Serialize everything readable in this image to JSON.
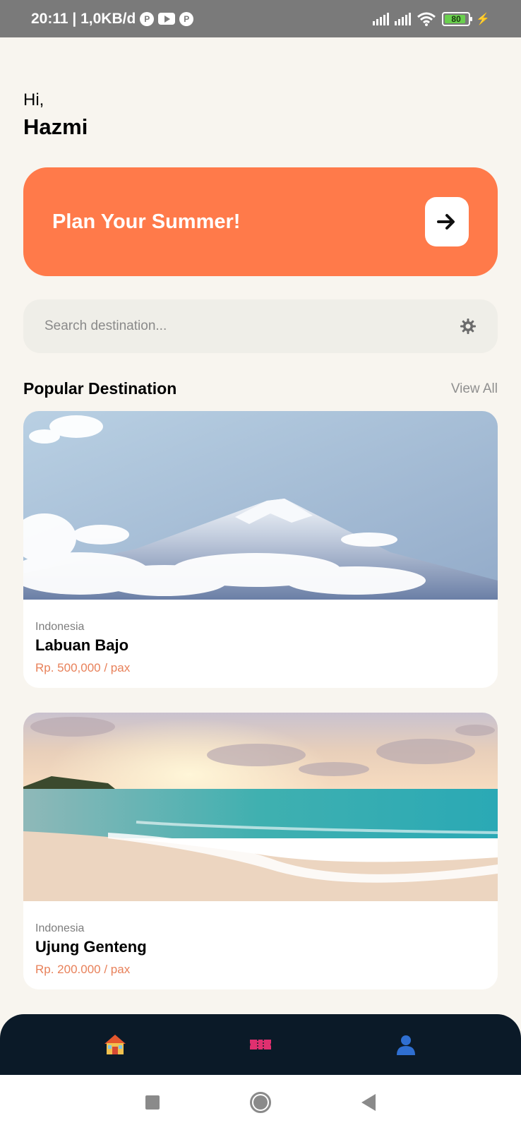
{
  "status_bar": {
    "time": "20:11 | 1,0KB/d",
    "battery_level": "80",
    "icons": [
      "app-notification-icon",
      "youtube-icon",
      "app-notification-icon",
      "signal-icon",
      "signal-icon",
      "wifi-icon",
      "battery-icon",
      "charging-icon"
    ]
  },
  "greeting": {
    "hi": "Hi,",
    "name": "Hazmi"
  },
  "banner": {
    "title": "Plan Your Summer!",
    "button_icon": "arrow-right-icon",
    "color": "#FF7A4A"
  },
  "search": {
    "placeholder": "Search destination...",
    "value": "",
    "icon": "gear-icon"
  },
  "section": {
    "title": "Popular Destination",
    "view_all": "View All"
  },
  "destinations": [
    {
      "country": "Indonesia",
      "name": "Labuan Bajo",
      "price": "Rp. 500,000 / pax",
      "image": "mountain-photo"
    },
    {
      "country": "Indonesia",
      "name": "Ujung Genteng",
      "price": "Rp. 200.000 / pax",
      "image": "beach-photo"
    }
  ],
  "bottom_nav": {
    "items": [
      {
        "icon": "home-icon"
      },
      {
        "icon": "ticket-icon"
      },
      {
        "icon": "profile-icon"
      }
    ],
    "background": "#0B1A28"
  },
  "colors": {
    "background": "#F8F5EF",
    "accent": "#FF7A4A",
    "price": "#E8815A"
  }
}
